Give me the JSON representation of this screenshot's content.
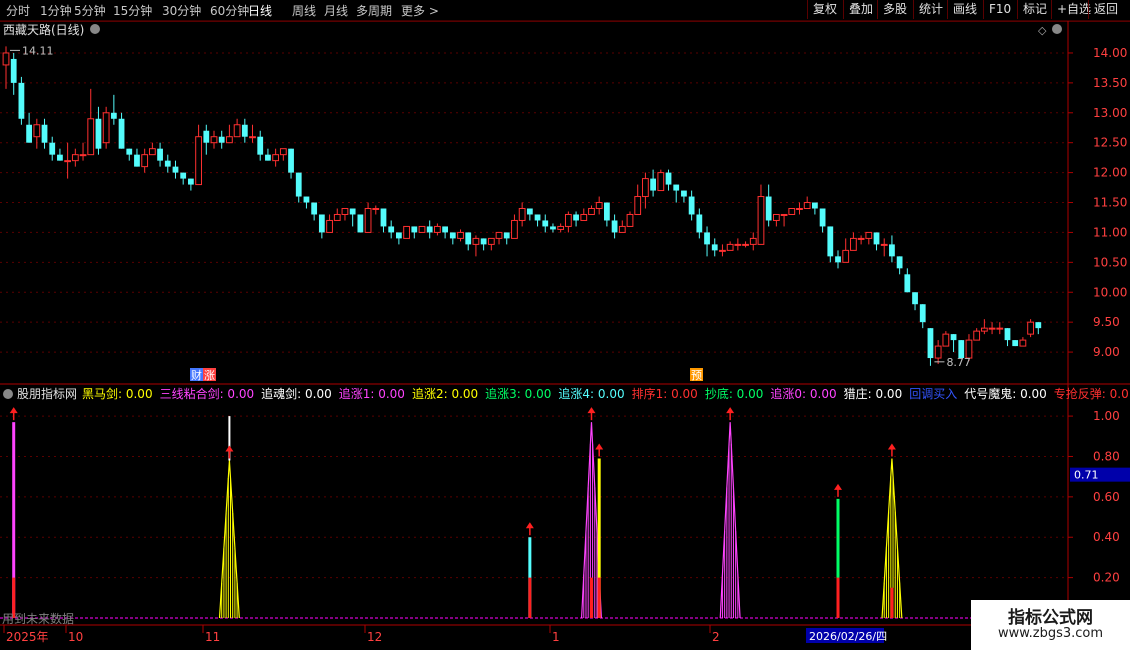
{
  "toolbar": {
    "periods": [
      "分时",
      "1分钟",
      "5分钟",
      "15分钟",
      "30分钟",
      "60分钟",
      "日线",
      "周线",
      "月线",
      "多周期",
      "更多 >"
    ],
    "active": "日线",
    "right_buttons": [
      "复权",
      "叠加",
      "多股",
      "统计",
      "画线",
      "F10",
      "标记",
      "+自选",
      "返回"
    ]
  },
  "main_panel": {
    "title": "西藏天路(日线)",
    "high_label": "14.11",
    "low_label": "8.77",
    "y_ticks": [
      "14.00",
      "13.50",
      "13.00",
      "12.50",
      "12.00",
      "11.50",
      "11.00",
      "10.50",
      "10.00",
      "9.50",
      "9.00"
    ],
    "markers": [
      "财",
      "涨",
      "预"
    ]
  },
  "indicator_panel": {
    "name": "股朋指标网",
    "legend": [
      {
        "label": "黑马剑:",
        "value": "0.00",
        "color": "#ffff00"
      },
      {
        "label": "三线粘合剑:",
        "value": "0.00",
        "color": "#ff44ff"
      },
      {
        "label": "追魂剑:",
        "value": "0.00",
        "color": "#ffffff"
      },
      {
        "label": "追涨1:",
        "value": "0.00",
        "color": "#ff44ff"
      },
      {
        "label": "追涨2:",
        "value": "0.00",
        "color": "#ffff00"
      },
      {
        "label": "追涨3:",
        "value": "0.00",
        "color": "#00ff66"
      },
      {
        "label": "追涨4:",
        "value": "0.00",
        "color": "#55ffff"
      },
      {
        "label": "排序1:",
        "value": "0.00",
        "color": "#ff3030"
      },
      {
        "label": "抄底:",
        "value": "0.00",
        "color": "#00ff66"
      },
      {
        "label": "追涨0:",
        "value": "0.00",
        "color": "#ff44ff"
      },
      {
        "label": "猎庄:",
        "value": "0.00",
        "color": "#ffffff"
      },
      {
        "label": "回调买入",
        "value": "",
        "color": "#3355ff"
      },
      {
        "label": "代号魔鬼:",
        "value": "0.00",
        "color": "#ffffff"
      },
      {
        "label": "专抢反弹:",
        "value": "0.0",
        "color": "#ff3030"
      }
    ],
    "y_ticks": [
      "1.00",
      "0.80",
      "0.60",
      "0.40",
      "0.20"
    ],
    "current_value": "0.71",
    "footer_note": "用到未来数据"
  },
  "time_axis": {
    "labels": [
      "2025年",
      "10",
      "11",
      "12",
      "1",
      "2"
    ],
    "cursor_date": "2026/02/26/四"
  },
  "watermark": {
    "line1": "指标公式网",
    "line2": "www.zbgs3.com"
  },
  "colors": {
    "up": "#ff3030",
    "down": "#54fcfc",
    "frame": "#ae0000",
    "grid": "#5a0000"
  },
  "chart_data": {
    "type": "candlestick",
    "ylim": [
      8.6,
      14.2
    ],
    "candles": [
      [
        13.8,
        14.0,
        14.11,
        13.4
      ],
      [
        13.9,
        13.5,
        14.0,
        13.3
      ],
      [
        13.5,
        12.9,
        13.6,
        12.8
      ],
      [
        12.8,
        12.5,
        13.0,
        12.5
      ],
      [
        12.6,
        12.8,
        12.9,
        12.4
      ],
      [
        12.8,
        12.5,
        12.9,
        12.4
      ],
      [
        12.5,
        12.3,
        12.6,
        12.2
      ],
      [
        12.3,
        12.2,
        12.4,
        12.2
      ],
      [
        12.2,
        12.2,
        12.5,
        11.9
      ],
      [
        12.2,
        12.3,
        12.4,
        12.1
      ],
      [
        12.3,
        12.3,
        12.5,
        12.2
      ],
      [
        12.3,
        12.9,
        13.4,
        12.3
      ],
      [
        12.9,
        12.4,
        13.1,
        12.3
      ],
      [
        12.5,
        13.0,
        13.1,
        12.4
      ],
      [
        13.0,
        12.9,
        13.3,
        12.8
      ],
      [
        12.9,
        12.4,
        13.0,
        12.4
      ],
      [
        12.4,
        12.3,
        12.4,
        12.2
      ],
      [
        12.3,
        12.1,
        12.4,
        12.1
      ],
      [
        12.1,
        12.3,
        12.4,
        12.0
      ],
      [
        12.3,
        12.4,
        12.5,
        12.3
      ],
      [
        12.4,
        12.2,
        12.5,
        12.1
      ],
      [
        12.2,
        12.1,
        12.3,
        12.0
      ],
      [
        12.1,
        12.0,
        12.2,
        11.9
      ],
      [
        12.0,
        11.9,
        12.0,
        11.8
      ],
      [
        11.9,
        11.8,
        11.9,
        11.7
      ],
      [
        11.8,
        12.6,
        12.8,
        11.8
      ],
      [
        12.7,
        12.5,
        12.8,
        12.3
      ],
      [
        12.5,
        12.6,
        12.7,
        12.4
      ],
      [
        12.6,
        12.5,
        12.7,
        12.4
      ],
      [
        12.5,
        12.6,
        12.8,
        12.5
      ],
      [
        12.6,
        12.8,
        12.9,
        12.6
      ],
      [
        12.8,
        12.6,
        12.9,
        12.5
      ],
      [
        12.6,
        12.6,
        12.8,
        12.5
      ],
      [
        12.6,
        12.3,
        12.7,
        12.2
      ],
      [
        12.3,
        12.2,
        12.4,
        12.2
      ],
      [
        12.2,
        12.3,
        12.4,
        12.1
      ],
      [
        12.3,
        12.4,
        12.4,
        12.2
      ],
      [
        12.4,
        12.0,
        12.4,
        11.9
      ],
      [
        12.0,
        11.6,
        12.0,
        11.5
      ],
      [
        11.6,
        11.5,
        11.6,
        11.4
      ],
      [
        11.5,
        11.3,
        11.5,
        11.2
      ],
      [
        11.3,
        11.0,
        11.3,
        10.9
      ],
      [
        11.0,
        11.2,
        11.3,
        11.0
      ],
      [
        11.2,
        11.3,
        11.4,
        11.2
      ],
      [
        11.3,
        11.4,
        11.4,
        11.2
      ],
      [
        11.4,
        11.3,
        11.4,
        11.1
      ],
      [
        11.3,
        11.0,
        11.3,
        11.0
      ],
      [
        11.0,
        11.4,
        11.5,
        11.0
      ],
      [
        11.4,
        11.4,
        11.45,
        11.3
      ],
      [
        11.4,
        11.1,
        11.4,
        11.0
      ],
      [
        11.1,
        11.0,
        11.2,
        10.9
      ],
      [
        11.0,
        10.9,
        11.0,
        10.8
      ],
      [
        10.9,
        11.1,
        11.1,
        10.9
      ],
      [
        11.1,
        11.0,
        11.1,
        10.9
      ],
      [
        11.0,
        11.1,
        11.1,
        11.0
      ],
      [
        11.1,
        11.0,
        11.2,
        10.9
      ],
      [
        11.0,
        11.1,
        11.15,
        10.95
      ],
      [
        11.1,
        11.0,
        11.1,
        10.9
      ],
      [
        11.0,
        10.9,
        11.0,
        10.8
      ],
      [
        10.9,
        11.0,
        11.05,
        10.85
      ],
      [
        11.0,
        10.8,
        11.0,
        10.7
      ],
      [
        10.8,
        10.9,
        10.95,
        10.6
      ],
      [
        10.9,
        10.8,
        10.9,
        10.7
      ],
      [
        10.8,
        10.9,
        10.9,
        10.7
      ],
      [
        10.9,
        11.0,
        11.0,
        10.8
      ],
      [
        11.0,
        10.9,
        11.0,
        10.8
      ],
      [
        10.9,
        11.2,
        11.3,
        10.9
      ],
      [
        11.2,
        11.4,
        11.5,
        11.1
      ],
      [
        11.4,
        11.3,
        11.4,
        11.2
      ],
      [
        11.3,
        11.2,
        11.3,
        11.1
      ],
      [
        11.2,
        11.1,
        11.3,
        11.0
      ],
      [
        11.1,
        11.05,
        11.15,
        11.0
      ],
      [
        11.05,
        11.1,
        11.15,
        11.0
      ],
      [
        11.1,
        11.3,
        11.35,
        11.0
      ],
      [
        11.3,
        11.2,
        11.35,
        11.1
      ],
      [
        11.2,
        11.3,
        11.4,
        11.2
      ],
      [
        11.3,
        11.4,
        11.45,
        11.3
      ],
      [
        11.4,
        11.5,
        11.6,
        11.3
      ],
      [
        11.5,
        11.2,
        11.5,
        11.1
      ],
      [
        11.2,
        11.0,
        11.3,
        10.9
      ],
      [
        11.0,
        11.1,
        11.2,
        11.0
      ],
      [
        11.1,
        11.3,
        11.35,
        11.1
      ],
      [
        11.3,
        11.6,
        11.8,
        11.3
      ],
      [
        11.6,
        11.9,
        12.0,
        11.4
      ],
      [
        11.9,
        11.7,
        12.05,
        11.6
      ],
      [
        11.7,
        12.0,
        12.05,
        11.8
      ],
      [
        12.0,
        11.8,
        12.05,
        11.7
      ],
      [
        11.8,
        11.7,
        11.8,
        11.5
      ],
      [
        11.7,
        11.6,
        11.7,
        11.5
      ],
      [
        11.6,
        11.3,
        11.7,
        11.2
      ],
      [
        11.3,
        11.0,
        11.4,
        10.9
      ],
      [
        11.0,
        10.8,
        11.1,
        10.6
      ],
      [
        10.8,
        10.7,
        10.9,
        10.6
      ],
      [
        10.7,
        10.7,
        10.8,
        10.6
      ],
      [
        10.7,
        10.8,
        10.85,
        10.7
      ],
      [
        10.8,
        10.8,
        10.9,
        10.7
      ],
      [
        10.8,
        10.8,
        10.85,
        10.75
      ],
      [
        10.8,
        10.9,
        11.0,
        10.7
      ],
      [
        10.8,
        11.6,
        11.8,
        10.8
      ],
      [
        11.6,
        11.2,
        11.8,
        11.1
      ],
      [
        11.2,
        11.3,
        11.3,
        11.1
      ],
      [
        11.3,
        11.3,
        11.3,
        11.1
      ],
      [
        11.3,
        11.4,
        11.4,
        11.3
      ],
      [
        11.4,
        11.4,
        11.5,
        11.3
      ],
      [
        11.4,
        11.5,
        11.6,
        11.4
      ],
      [
        11.5,
        11.4,
        11.5,
        11.3
      ],
      [
        11.4,
        11.1,
        11.4,
        11.0
      ],
      [
        11.1,
        10.6,
        11.1,
        10.5
      ],
      [
        10.6,
        10.5,
        10.7,
        10.4
      ],
      [
        10.5,
        10.7,
        10.9,
        10.5
      ],
      [
        10.7,
        10.9,
        11.0,
        10.7
      ],
      [
        10.9,
        10.9,
        10.95,
        10.8
      ],
      [
        10.9,
        11.0,
        11.0,
        10.8
      ],
      [
        11.0,
        10.8,
        11.0,
        10.7
      ],
      [
        10.8,
        10.8,
        10.9,
        10.6
      ],
      [
        10.8,
        10.6,
        10.95,
        10.5
      ],
      [
        10.6,
        10.4,
        10.6,
        10.3
      ],
      [
        10.3,
        10.0,
        10.4,
        10.0
      ],
      [
        10.0,
        9.8,
        10.0,
        9.7
      ],
      [
        9.8,
        9.5,
        9.8,
        9.4
      ],
      [
        9.4,
        8.9,
        9.4,
        8.77
      ],
      [
        8.9,
        9.1,
        9.2,
        8.8
      ],
      [
        9.1,
        9.3,
        9.35,
        9.1
      ],
      [
        9.3,
        9.2,
        9.3,
        9.0
      ],
      [
        9.2,
        8.9,
        9.2,
        8.9
      ],
      [
        8.9,
        9.2,
        9.3,
        8.85
      ],
      [
        9.2,
        9.35,
        9.4,
        9.2
      ],
      [
        9.35,
        9.4,
        9.55,
        9.3
      ],
      [
        9.4,
        9.4,
        9.5,
        9.3
      ],
      [
        9.4,
        9.4,
        9.5,
        9.3
      ],
      [
        9.4,
        9.2,
        9.4,
        9.1
      ],
      [
        9.2,
        9.1,
        9.2,
        9.1
      ],
      [
        9.1,
        9.2,
        9.25,
        9.1
      ],
      [
        9.3,
        9.5,
        9.55,
        9.25
      ],
      [
        9.5,
        9.4,
        9.5,
        9.3
      ]
    ],
    "indicator_ylim": [
      0,
      1.05
    ],
    "signals": [
      {
        "index": 1,
        "value": 0.97,
        "color": "#ff44ff",
        "shape": "bar",
        "arrow": true,
        "red_base": 0.2
      },
      {
        "index": 29,
        "value": 0.78,
        "color": "#ffff00",
        "shape": "spike",
        "arrow": true,
        "tip": "#ffffff",
        "tip_value": 1.0
      },
      {
        "index": 68,
        "value": 0.4,
        "color": "#55ffff",
        "shape": "bar",
        "arrow": true,
        "red_base": 0.2
      },
      {
        "index": 76,
        "value": 0.97,
        "color": "#ff44ff",
        "shape": "spike",
        "arrow": true,
        "red_base": 0.2
      },
      {
        "index": 77,
        "value": 0.79,
        "color": "#ffff00",
        "shape": "bar",
        "arrow": true,
        "red_base": 0.2
      },
      {
        "index": 94,
        "value": 0.97,
        "color": "#ff44ff",
        "shape": "spike",
        "arrow": true
      },
      {
        "index": 108,
        "value": 0.59,
        "color": "#00ff66",
        "shape": "bar",
        "arrow": true,
        "red_base": 0.2
      },
      {
        "index": 115,
        "value": 0.79,
        "color": "#ffff00",
        "shape": "spike",
        "arrow": true,
        "red_base": 0.15
      }
    ]
  }
}
